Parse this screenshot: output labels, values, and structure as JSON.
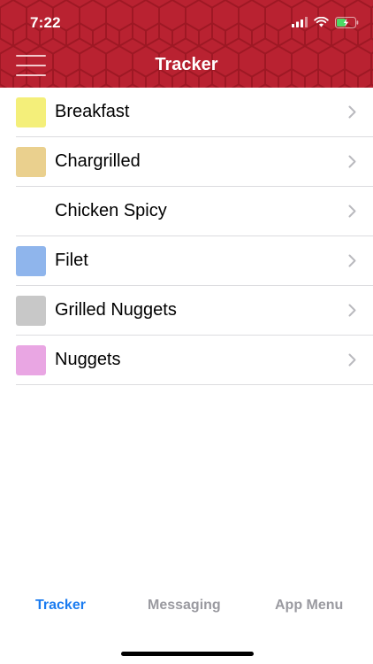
{
  "status_bar": {
    "time": "7:22",
    "icons": [
      "signal-icon",
      "wifi-icon",
      "battery-charging-icon"
    ]
  },
  "header": {
    "title": "Tracker",
    "menu_icon": "hamburger-menu-icon",
    "color": "#b5202e"
  },
  "list": {
    "items": [
      {
        "label": "Breakfast",
        "color": "#f4ef7a"
      },
      {
        "label": "Chargrilled",
        "color": "#ead08e"
      },
      {
        "label": "Chicken Spicy",
        "color": ""
      },
      {
        "label": "Filet",
        "color": "#8fb5ec"
      },
      {
        "label": "Grilled Nuggets",
        "color": "#c8c8c8"
      },
      {
        "label": "Nuggets",
        "color": "#e9a6e3"
      }
    ],
    "chevron_icon": "chevron-right-icon"
  },
  "tab_bar": {
    "tabs": [
      {
        "label": "Tracker",
        "active": true
      },
      {
        "label": "Messaging",
        "active": false
      },
      {
        "label": "App Menu",
        "active": false
      }
    ],
    "active_color": "#1b7cf0",
    "inactive_color": "#9a9aa0"
  }
}
